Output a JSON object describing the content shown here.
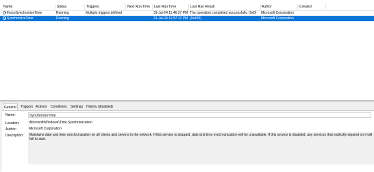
{
  "columns": {
    "name": "Name",
    "status": "Status",
    "triggers": "Triggers",
    "next_run": "Next Run Time",
    "last_run": "Last Run Time",
    "last_result": "Last Run Result",
    "author": "Author",
    "created": "Created"
  },
  "tasks": [
    {
      "name": "ForceSynchronizeTime",
      "status": "Running",
      "triggers": "Multiple triggers defined",
      "next_run": "",
      "last_run": "31-Jul-24 11:46:27 PM",
      "last_result": "The operation completed successfully. (0x0)",
      "author": "Microsoft Corporation",
      "created": "",
      "selected": false
    },
    {
      "name": "SynchronizeTime",
      "status": "Running",
      "triggers": "",
      "next_run": "",
      "last_run": "31-Jul-24 11:57:12 PM",
      "last_result": "(0x420)",
      "author": "Microsoft Corporation",
      "created": "",
      "selected": true
    }
  ],
  "tabs": [
    "General",
    "Triggers",
    "Actions",
    "Conditions",
    "Settings",
    "History (disabled)"
  ],
  "general": {
    "name_label": "Name:",
    "name_value": "SynchronizeTime",
    "location_label": "Location:",
    "location_value": "\\Microsoft\\Windows\\Time Synchronization",
    "author_label": "Author:",
    "author_value": "Microsoft Corporation",
    "description_label": "Description:",
    "description_value": "Maintains date and time synchronization on all clients and servers in the network. If this service is stopped, date and time synchronization will be unavailable. If this service is disabled, any services that explicitly depend on it will fail to start."
  },
  "colors": {
    "selection": "#0a75d9",
    "panel": "#f0f0f0"
  },
  "icons": {
    "task": "task-scheduler-icon"
  }
}
